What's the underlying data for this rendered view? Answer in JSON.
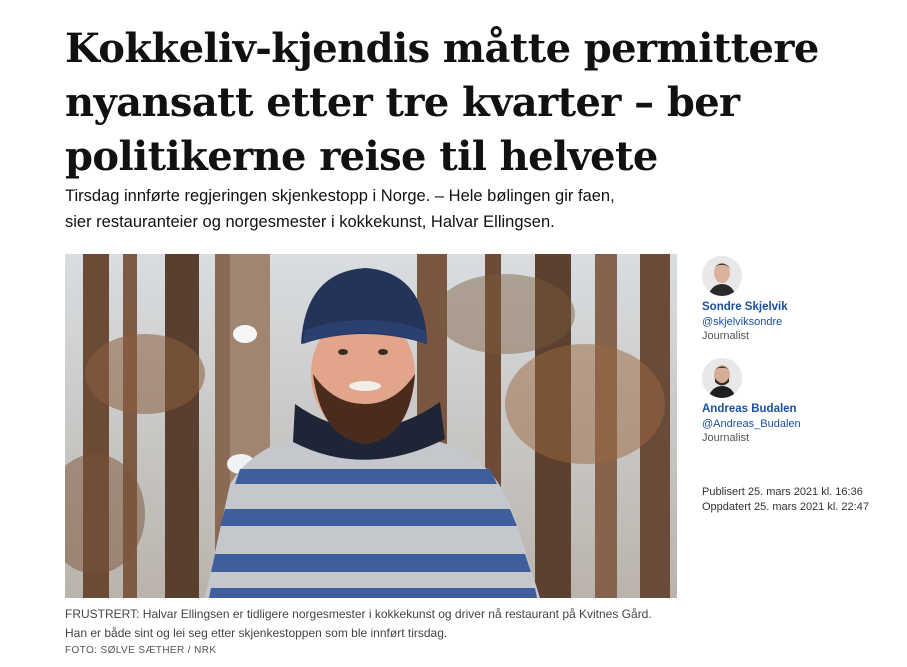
{
  "article": {
    "headline": "Kokkeliv-kjendis måtte permittere nyansatt etter tre kvarter – ber politikerne reise til helvete",
    "lead": "Tirsdag innførte regjeringen skjenkestopp i Norge. – Hele bølingen gir faen, sier restauranteier og norgesmester i kokkekunst, Halvar Ellingsen.",
    "caption": "FRUSTRERT: Halvar Ellingsen er tidligere norgesmester i kokkekunst og driver nå restaurant på Kvitnes Gård. Han er både sint og lei seg etter skjenkestoppen som ble innført tirsdag.",
    "photo_credit": "FOTO: SØLVE SÆTHER / NRK"
  },
  "authors": [
    {
      "name": "Sondre Skjelvik",
      "handle": "@skjelviksondre",
      "role": "Journalist"
    },
    {
      "name": "Andreas Budalen",
      "handle": "@Andreas_Budalen",
      "role": "Journalist"
    }
  ],
  "dates": {
    "published": "Publisert 25. mars 2021 kl. 16:36",
    "updated": "Oppdatert 25. mars 2021 kl. 22:47"
  },
  "colors": {
    "link": "#1a4fa3",
    "text": "#111111",
    "caption": "#444444"
  },
  "icons": {
    "author_1": "avatar",
    "author_2": "avatar"
  }
}
